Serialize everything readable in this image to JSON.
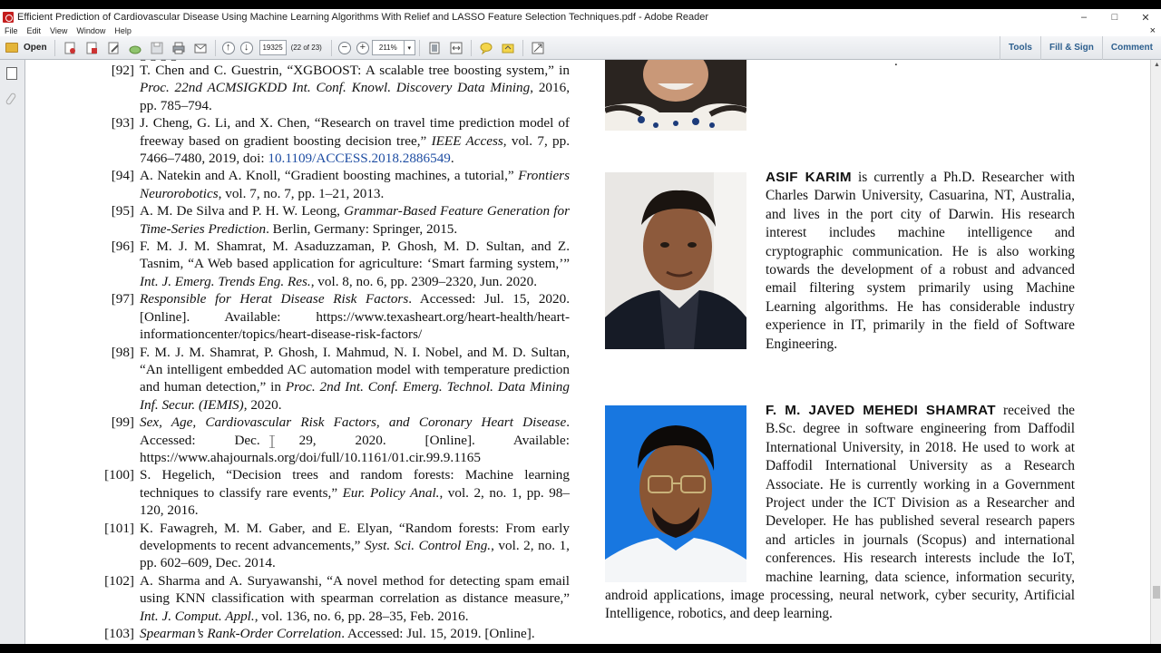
{
  "window": {
    "title": "Efficient Prediction of Cardiovascular Disease Using Machine Learning Algorithms With Relief and LASSO Feature Selection Techniques.pdf - Adobe Reader",
    "controls": [
      "–",
      "□",
      "✕"
    ]
  },
  "menu": [
    "File",
    "Edit",
    "View",
    "Window",
    "Help"
  ],
  "toolbar": {
    "open_label": "Open",
    "page_value": "19325",
    "page_count": "(22 of 23)",
    "zoom_value": "211%",
    "tabs": [
      "Tools",
      "Fill & Sign",
      "Comment"
    ]
  },
  "references": [
    {
      "num": "[92]",
      "parts": [
        {
          "t": "T. Chen and C. Guestrin, “XGBOOST: A scalable tree boosting system,” in "
        },
        {
          "t": "Proc. 22nd ACMSIGKDD Int. Conf. Knowl. Discovery Data Mining",
          "i": true
        },
        {
          "t": ", 2016, pp. 785–794."
        }
      ]
    },
    {
      "num": "[93]",
      "parts": [
        {
          "t": "J. Cheng, G. Li, and X. Chen, “Research on travel time prediction model of freeway based on gradient boosting decision tree,” "
        },
        {
          "t": "IEEE Access",
          "i": true
        },
        {
          "t": ", vol. 7, pp. 7466–7480, 2019, doi: "
        },
        {
          "t": "10.1109/ACCESS.2018.2886549",
          "link": true
        },
        {
          "t": "."
        }
      ]
    },
    {
      "num": "[94]",
      "parts": [
        {
          "t": "A. Natekin and A. Knoll, “Gradient boosting machines, a tutorial,” "
        },
        {
          "t": "Frontiers Neurorobotics",
          "i": true
        },
        {
          "t": ", vol. 7, no. 7, pp. 1–21, 2013."
        }
      ]
    },
    {
      "num": "[95]",
      "parts": [
        {
          "t": "A. M. De Silva and P. H. W. Leong, "
        },
        {
          "t": "Grammar-Based Feature Generation for Time-Series Prediction",
          "i": true
        },
        {
          "t": ". Berlin, Germany: Springer, 2015."
        }
      ]
    },
    {
      "num": "[96]",
      "parts": [
        {
          "t": "F. M. J. M. Shamrat, M. Asaduzzaman, P. Ghosh, M. D. Sultan, and Z. Tasnim, “A Web based application for agriculture: ‘Smart farming system,’” "
        },
        {
          "t": "Int. J. Emerg. Trends Eng. Res.",
          "i": true
        },
        {
          "t": ", vol. 8, no. 6, pp. 2309–2320, Jun. 2020."
        }
      ]
    },
    {
      "num": "[97]",
      "parts": [
        {
          "t": "Responsible for Herat Disease Risk Factors",
          "i": true
        },
        {
          "t": ". Accessed: Jul. 15, 2020. [Online]. Available: https://www.texasheart.org/heart-health/heart-informationcenter/topics/heart-disease-risk-factors/"
        }
      ]
    },
    {
      "num": "[98]",
      "parts": [
        {
          "t": "F. M. J. M. Shamrat, P. Ghosh, I. Mahmud, N. I. Nobel, and M. D. Sultan, “An intelligent embedded AC automation model with temperature prediction and human detection,” in "
        },
        {
          "t": "Proc. 2nd Int. Conf. Emerg. Technol. Data Mining Inf. Secur. (IEMIS)",
          "i": true
        },
        {
          "t": ", 2020."
        }
      ]
    },
    {
      "num": "[99]",
      "parts": [
        {
          "t": "Sex, Age, Cardiovascular Risk Factors, and Coronary Heart Disease",
          "i": true
        },
        {
          "t": ". Accessed: Dec. 29, 2020. [Online]. Available: https://www.ahajournals.org/doi/full/10.1161/01.cir.99.9.1165"
        }
      ]
    },
    {
      "num": "[100]",
      "parts": [
        {
          "t": "S. Hegelich, “Decision trees and random forests: Machine learning techniques to classify rare events,” "
        },
        {
          "t": "Eur. Policy Anal.",
          "i": true
        },
        {
          "t": ", vol. 2, no. 1, pp. 98–120, 2016."
        }
      ]
    },
    {
      "num": "[101]",
      "parts": [
        {
          "t": "K. Fawagreh, M. M. Gaber, and E. Elyan, “Random forests: From early developments to recent advancements,” "
        },
        {
          "t": "Syst. Sci. Control Eng.",
          "i": true
        },
        {
          "t": ", vol. 2, no. 1, pp. 602–609, Dec. 2014."
        }
      ]
    },
    {
      "num": "[102]",
      "parts": [
        {
          "t": "A. Sharma and A. Suryawanshi, “A novel method for detecting spam email using KNN classification with spearman correlation as distance measure,” "
        },
        {
          "t": "Int. J. Comput. Appl.",
          "i": true
        },
        {
          "t": ", vol. 136, no. 6, pp. 28–35, Feb. 2016."
        }
      ]
    },
    {
      "num": "[103]",
      "parts": [
        {
          "t": "Spearman’s Rank-Order Correlation",
          "i": true
        },
        {
          "t": ". Accessed: Jul. 15, 2019. [Online]."
        }
      ]
    }
  ],
  "bios": {
    "asif": {
      "name": "ASIF KARIM",
      "text": " is currently a Ph.D. Researcher with Charles Darwin University, Casuarina, NT, Australia, and lives in the port city of Darwin. His research interest includes machine intelligence and cryptographic communication. He is also working towards the development of a robust and advanced email filtering system primarily using Machine Learning algorithms. He has considerable industry experience in IT, primarily in the field of Software Engineering."
    },
    "shamrat": {
      "name": "F. M. JAVED MEHEDI SHAMRAT",
      "text": " received the B.Sc. degree in software engineering from Daffodil International University, in 2018. He used to work at Daffodil International University as a Research Associate. He is currently working in a Government Project under the ICT Division as a Researcher and Developer. He has published several research papers and articles in journals (Scopus) and international conferences. His research interests include the IoT, machine learning, data science, information security, android applications, image processing, neural network, cyber security, Artificial Intelligence, robotics, and deep learning."
    }
  },
  "colors": {
    "link": "#1f4ea3",
    "tab_text": "#2d5f8e",
    "photo_bg_blue": "#1877e0"
  }
}
